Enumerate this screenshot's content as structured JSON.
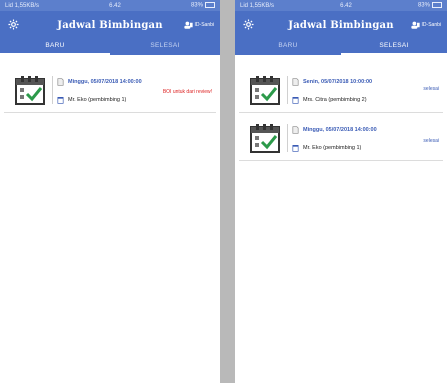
{
  "left": {
    "status_bar": {
      "signal": "Lid 1,55KB/s",
      "time": "6.42",
      "battery": "83%"
    },
    "app_bar": {
      "title": "Jadwal Bimbingan",
      "right_label": "ID-Sanbi"
    },
    "tabs": [
      {
        "label": "BARU"
      },
      {
        "label": "SELESAI"
      }
    ],
    "items": [
      {
        "date": "Minggu, 05/07/2018 14:00:00",
        "lecturer": "Mr. Eko (pembimbing 1)",
        "status": "BOI untuk dari review!"
      }
    ]
  },
  "right": {
    "status_bar": {
      "signal": "Lid 1,55KB/s",
      "time": "6.42",
      "battery": "83%"
    },
    "app_bar": {
      "title": "Jadwal Bimbingan",
      "right_label": "ID-Sanbi"
    },
    "tabs": [
      {
        "label": "BARU"
      },
      {
        "label": "SELESAI"
      }
    ],
    "items": [
      {
        "date": "Senin, 05/07/2018 10:00:00",
        "lecturer": "Mrs. Citra (pembimbing 2)",
        "status": "selesai"
      },
      {
        "date": "Minggu, 05/07/2018 14:00:00",
        "lecturer": "Mr. Eko (pembimbing 1)",
        "status": "selesai"
      }
    ]
  },
  "colors": {
    "primary": "#4a6fc4",
    "status_bar": "#5c7fcc",
    "accent_red": "#d22222",
    "date_blue": "#3a5bb5"
  },
  "icons": [
    "gear-icon",
    "profile-icon",
    "calendar-check-icon",
    "document-icon",
    "calendar-icon"
  ]
}
